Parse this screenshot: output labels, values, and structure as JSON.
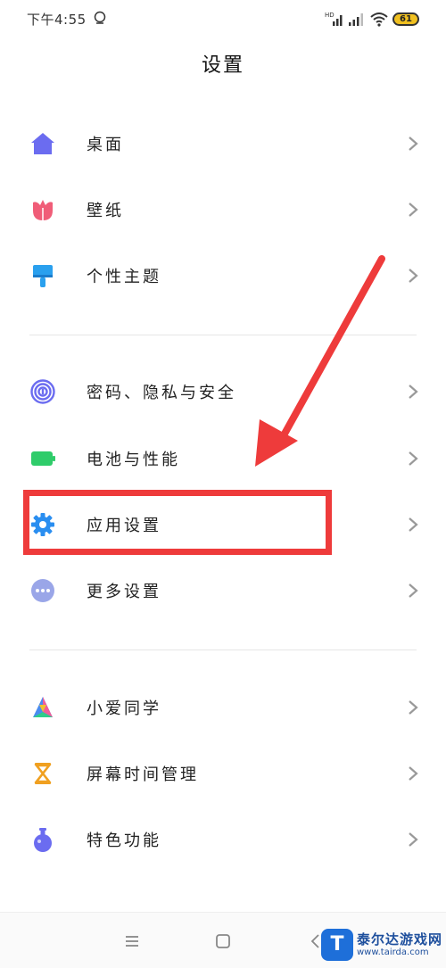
{
  "status": {
    "time": "下午4:55",
    "network": "HD",
    "battery": "61"
  },
  "header": {
    "title": "设置"
  },
  "groups": [
    {
      "items": [
        {
          "label": "桌面",
          "icon": "home-icon",
          "color": "#6b6cf0"
        },
        {
          "label": "壁纸",
          "icon": "tulip-icon",
          "color": "#f05d78"
        },
        {
          "label": "个性主题",
          "icon": "paintbrush-icon",
          "color": "#2aa0ee"
        }
      ]
    },
    {
      "items": [
        {
          "label": "密码、隐私与安全",
          "icon": "fingerprint-icon",
          "color": "#6b6cf0"
        },
        {
          "label": "电池与性能",
          "icon": "battery-icon",
          "color": "#2fcc6a"
        },
        {
          "label": "应用设置",
          "icon": "gear-icon",
          "color": "#2a8ef0"
        },
        {
          "label": "更多设置",
          "icon": "more-icon",
          "color": "#9aa6e8"
        }
      ]
    },
    {
      "items": [
        {
          "label": "小爱同学",
          "icon": "xiaoai-icon",
          "color": "#4a8cf0"
        },
        {
          "label": "屏幕时间管理",
          "icon": "hourglass-icon",
          "color": "#f0a020"
        },
        {
          "label": "特色功能",
          "icon": "flask-icon",
          "color": "#6b6cf0"
        }
      ]
    }
  ],
  "annotation": {
    "highlight_color": "#ee3b3b"
  },
  "watermark": {
    "name": "泰尔达游戏网",
    "url": "www.tairda.com",
    "logo_letter": "T"
  }
}
